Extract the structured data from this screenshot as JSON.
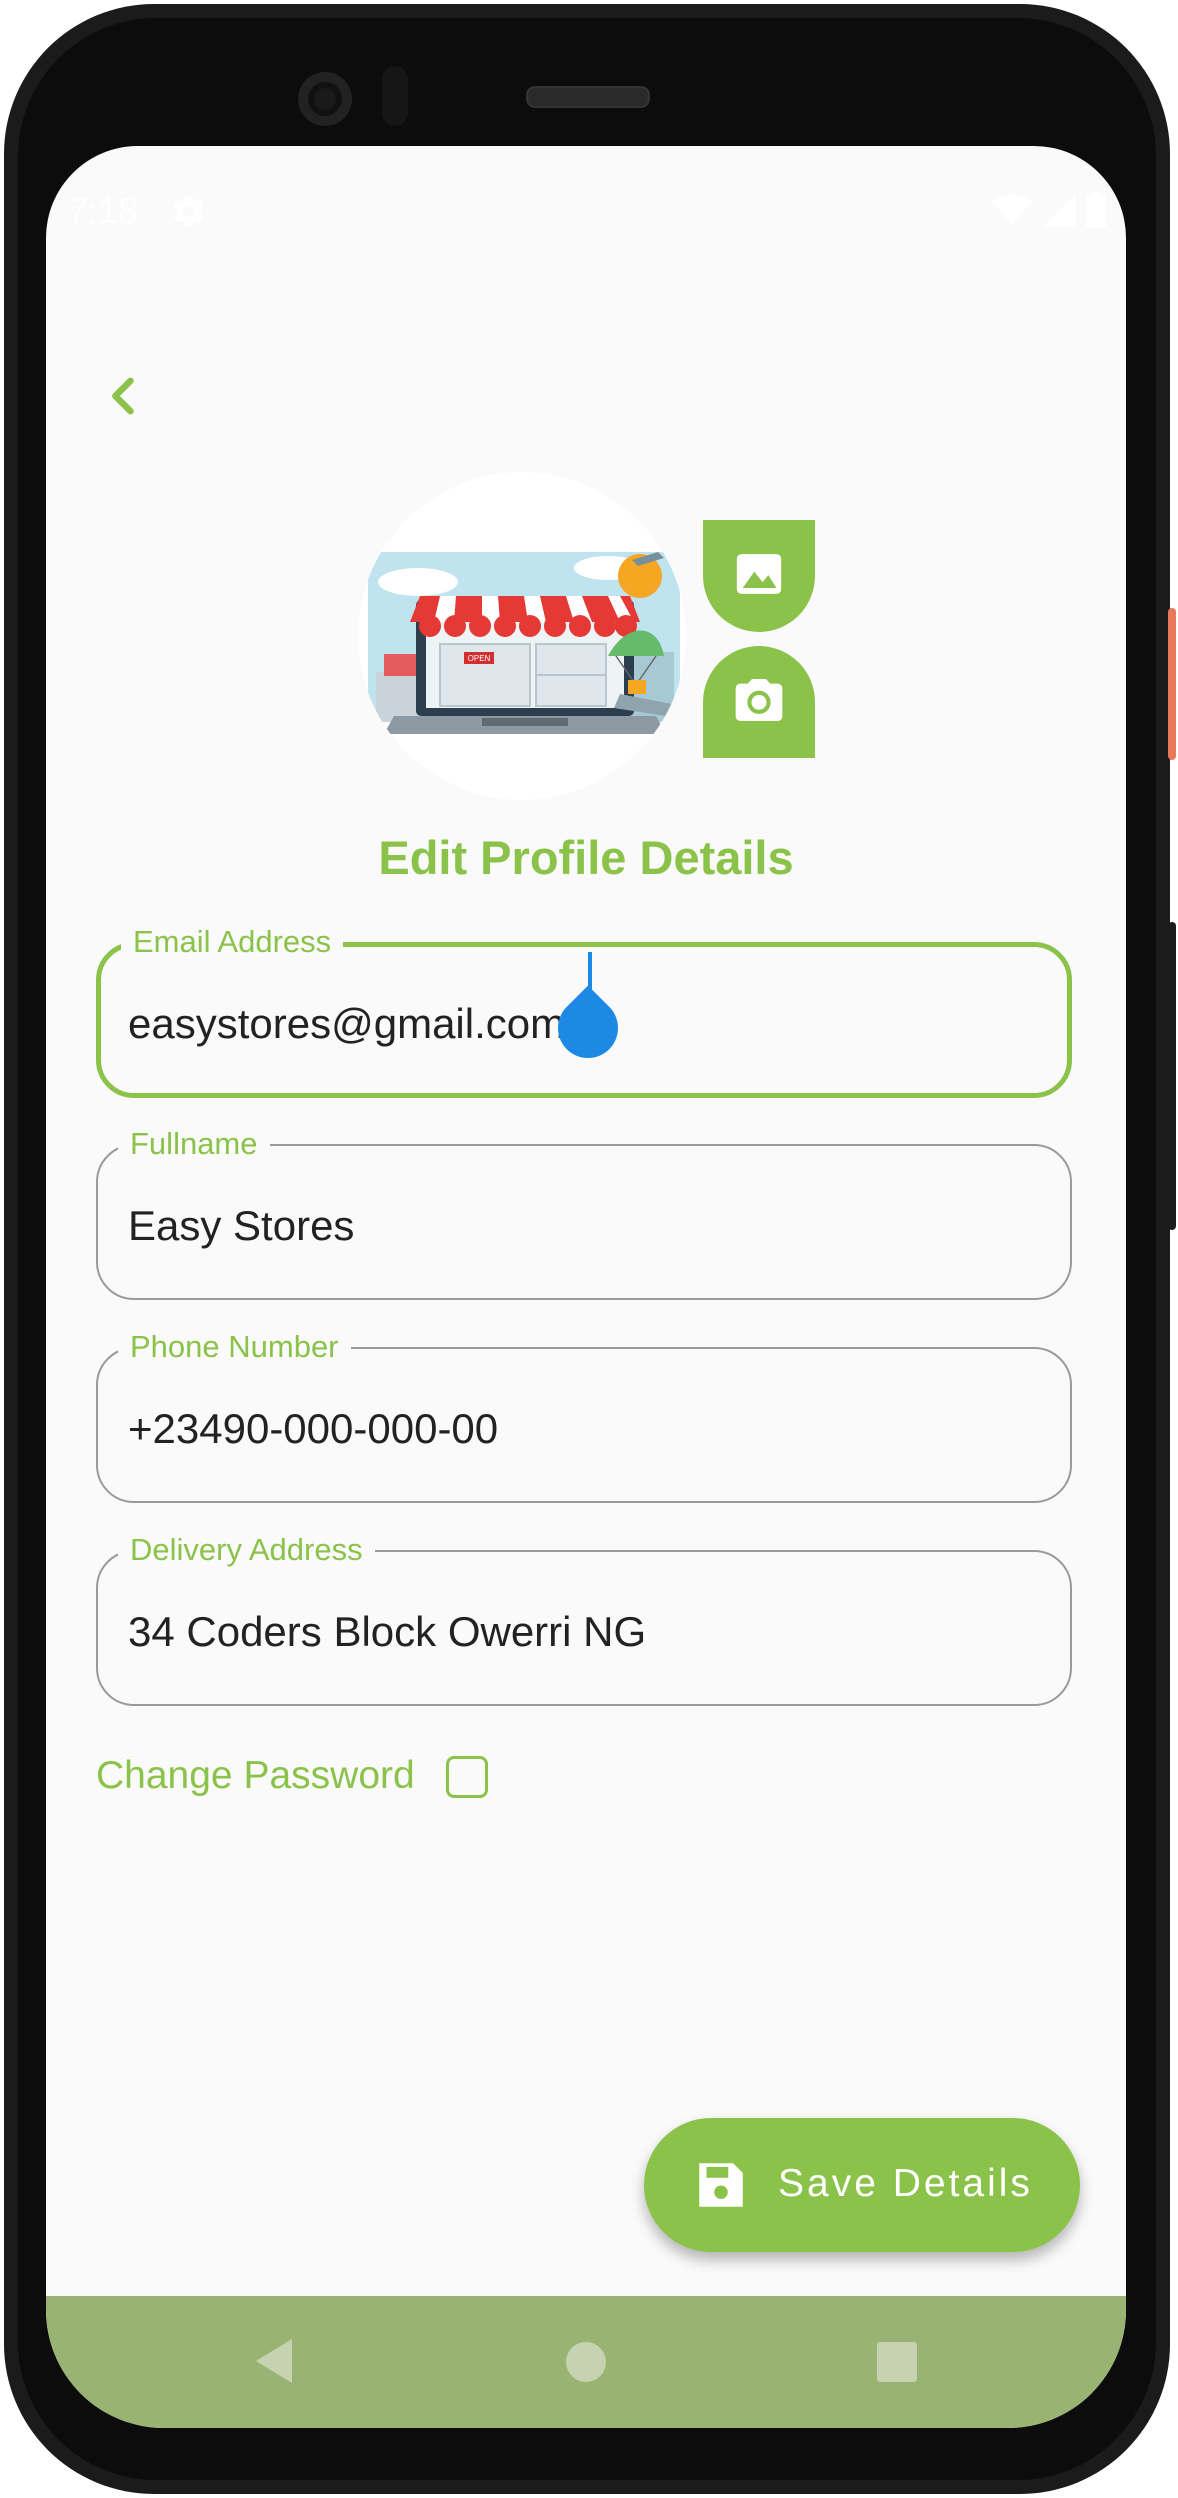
{
  "status_bar": {
    "time": "7:18"
  },
  "app": {
    "title": "Edit Profile Details",
    "accent_color": "#8bc34a",
    "icons": {
      "back": "chevron-left-icon",
      "gallery": "image-icon",
      "camera": "camera-icon",
      "save": "floppy-disk-icon"
    }
  },
  "form": {
    "email": {
      "label": "Email Address",
      "value": "easystores@gmail.com"
    },
    "fullname": {
      "label": "Fullname",
      "value": "Easy Stores"
    },
    "phone": {
      "label": "Phone Number",
      "value": "+23490-000-000-00"
    },
    "address": {
      "label": "Delivery Address",
      "value": "34 Coders Block Owerri NG"
    },
    "change_password": {
      "label": "Change Password",
      "checked": false
    }
  },
  "actions": {
    "save_label": "Save Details"
  },
  "avatar": {
    "sign_text": "OPEN"
  }
}
